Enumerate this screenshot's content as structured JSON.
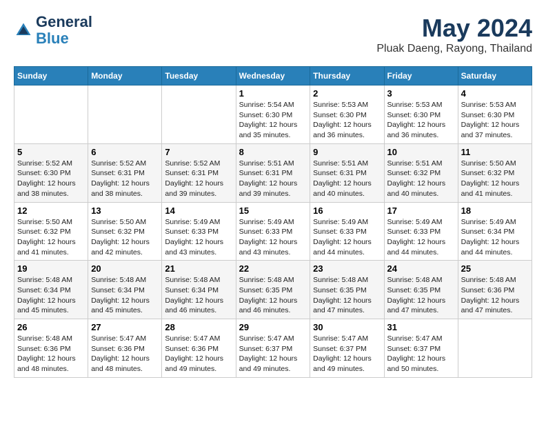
{
  "header": {
    "logo_line1": "General",
    "logo_line2": "Blue",
    "main_title": "May 2024",
    "subtitle": "Pluak Daeng, Rayong, Thailand"
  },
  "days_of_week": [
    "Sunday",
    "Monday",
    "Tuesday",
    "Wednesday",
    "Thursday",
    "Friday",
    "Saturday"
  ],
  "weeks": [
    [
      {
        "day": "",
        "info": ""
      },
      {
        "day": "",
        "info": ""
      },
      {
        "day": "",
        "info": ""
      },
      {
        "day": "1",
        "info": "Sunrise: 5:54 AM\nSunset: 6:30 PM\nDaylight: 12 hours\nand 35 minutes."
      },
      {
        "day": "2",
        "info": "Sunrise: 5:53 AM\nSunset: 6:30 PM\nDaylight: 12 hours\nand 36 minutes."
      },
      {
        "day": "3",
        "info": "Sunrise: 5:53 AM\nSunset: 6:30 PM\nDaylight: 12 hours\nand 36 minutes."
      },
      {
        "day": "4",
        "info": "Sunrise: 5:53 AM\nSunset: 6:30 PM\nDaylight: 12 hours\nand 37 minutes."
      }
    ],
    [
      {
        "day": "5",
        "info": "Sunrise: 5:52 AM\nSunset: 6:30 PM\nDaylight: 12 hours\nand 38 minutes."
      },
      {
        "day": "6",
        "info": "Sunrise: 5:52 AM\nSunset: 6:31 PM\nDaylight: 12 hours\nand 38 minutes."
      },
      {
        "day": "7",
        "info": "Sunrise: 5:52 AM\nSunset: 6:31 PM\nDaylight: 12 hours\nand 39 minutes."
      },
      {
        "day": "8",
        "info": "Sunrise: 5:51 AM\nSunset: 6:31 PM\nDaylight: 12 hours\nand 39 minutes."
      },
      {
        "day": "9",
        "info": "Sunrise: 5:51 AM\nSunset: 6:31 PM\nDaylight: 12 hours\nand 40 minutes."
      },
      {
        "day": "10",
        "info": "Sunrise: 5:51 AM\nSunset: 6:32 PM\nDaylight: 12 hours\nand 40 minutes."
      },
      {
        "day": "11",
        "info": "Sunrise: 5:50 AM\nSunset: 6:32 PM\nDaylight: 12 hours\nand 41 minutes."
      }
    ],
    [
      {
        "day": "12",
        "info": "Sunrise: 5:50 AM\nSunset: 6:32 PM\nDaylight: 12 hours\nand 41 minutes."
      },
      {
        "day": "13",
        "info": "Sunrise: 5:50 AM\nSunset: 6:32 PM\nDaylight: 12 hours\nand 42 minutes."
      },
      {
        "day": "14",
        "info": "Sunrise: 5:49 AM\nSunset: 6:33 PM\nDaylight: 12 hours\nand 43 minutes."
      },
      {
        "day": "15",
        "info": "Sunrise: 5:49 AM\nSunset: 6:33 PM\nDaylight: 12 hours\nand 43 minutes."
      },
      {
        "day": "16",
        "info": "Sunrise: 5:49 AM\nSunset: 6:33 PM\nDaylight: 12 hours\nand 44 minutes."
      },
      {
        "day": "17",
        "info": "Sunrise: 5:49 AM\nSunset: 6:33 PM\nDaylight: 12 hours\nand 44 minutes."
      },
      {
        "day": "18",
        "info": "Sunrise: 5:49 AM\nSunset: 6:34 PM\nDaylight: 12 hours\nand 44 minutes."
      }
    ],
    [
      {
        "day": "19",
        "info": "Sunrise: 5:48 AM\nSunset: 6:34 PM\nDaylight: 12 hours\nand 45 minutes."
      },
      {
        "day": "20",
        "info": "Sunrise: 5:48 AM\nSunset: 6:34 PM\nDaylight: 12 hours\nand 45 minutes."
      },
      {
        "day": "21",
        "info": "Sunrise: 5:48 AM\nSunset: 6:34 PM\nDaylight: 12 hours\nand 46 minutes."
      },
      {
        "day": "22",
        "info": "Sunrise: 5:48 AM\nSunset: 6:35 PM\nDaylight: 12 hours\nand 46 minutes."
      },
      {
        "day": "23",
        "info": "Sunrise: 5:48 AM\nSunset: 6:35 PM\nDaylight: 12 hours\nand 47 minutes."
      },
      {
        "day": "24",
        "info": "Sunrise: 5:48 AM\nSunset: 6:35 PM\nDaylight: 12 hours\nand 47 minutes."
      },
      {
        "day": "25",
        "info": "Sunrise: 5:48 AM\nSunset: 6:36 PM\nDaylight: 12 hours\nand 47 minutes."
      }
    ],
    [
      {
        "day": "26",
        "info": "Sunrise: 5:48 AM\nSunset: 6:36 PM\nDaylight: 12 hours\nand 48 minutes."
      },
      {
        "day": "27",
        "info": "Sunrise: 5:47 AM\nSunset: 6:36 PM\nDaylight: 12 hours\nand 48 minutes."
      },
      {
        "day": "28",
        "info": "Sunrise: 5:47 AM\nSunset: 6:36 PM\nDaylight: 12 hours\nand 49 minutes."
      },
      {
        "day": "29",
        "info": "Sunrise: 5:47 AM\nSunset: 6:37 PM\nDaylight: 12 hours\nand 49 minutes."
      },
      {
        "day": "30",
        "info": "Sunrise: 5:47 AM\nSunset: 6:37 PM\nDaylight: 12 hours\nand 49 minutes."
      },
      {
        "day": "31",
        "info": "Sunrise: 5:47 AM\nSunset: 6:37 PM\nDaylight: 12 hours\nand 50 minutes."
      },
      {
        "day": "",
        "info": ""
      }
    ]
  ]
}
